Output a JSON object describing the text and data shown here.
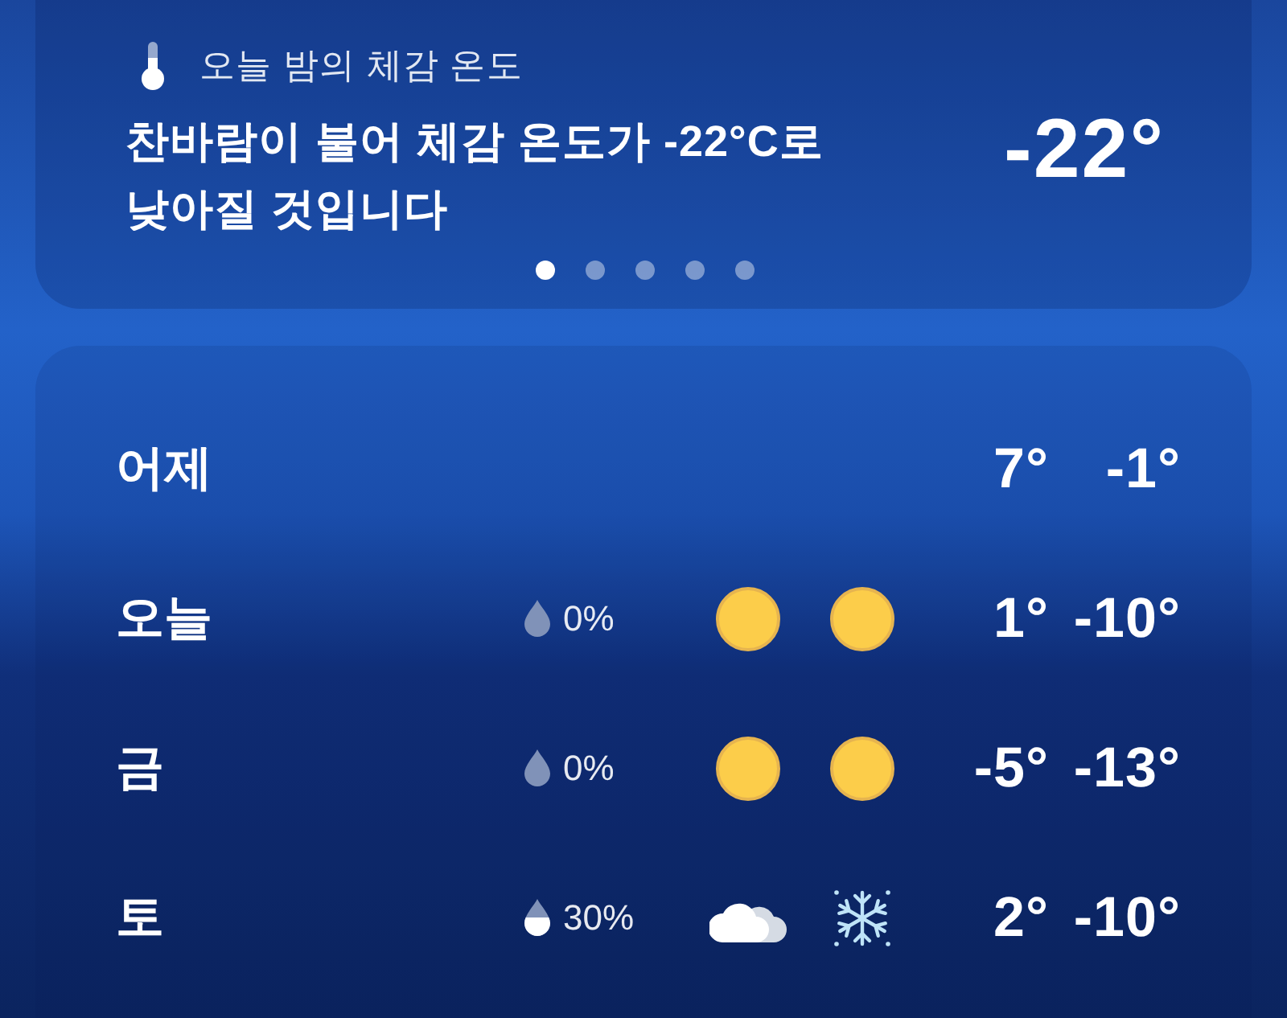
{
  "feels_like_card": {
    "title": "오늘 밤의 체감 온도",
    "message": "찬바람이 불어 체감 온도가 -22°C로 낮아질 것입니다",
    "value": "-22°",
    "pages": [
      {
        "selected": true
      },
      {
        "selected": false
      },
      {
        "selected": false
      },
      {
        "selected": false
      },
      {
        "selected": false
      }
    ]
  },
  "forecast": {
    "days": [
      {
        "day": "어제",
        "high": "7°",
        "low": "-1°"
      },
      {
        "day": "오늘",
        "precip": {
          "text": "0%"
        },
        "icons": [
          {
            "kind": "sun"
          },
          {
            "kind": "sun"
          }
        ],
        "high": "1°",
        "low": "-10°"
      },
      {
        "day": "금",
        "precip": {
          "text": "0%"
        },
        "icons": [
          {
            "kind": "sun"
          },
          {
            "kind": "sun"
          }
        ],
        "high": "-5°",
        "low": "-13°"
      },
      {
        "day": "토",
        "precip": {
          "text": "30%",
          "level": 0.5
        },
        "icons": [
          {
            "kind": "cloud"
          },
          {
            "kind": "snow"
          }
        ],
        "high": "2°",
        "low": "-10°"
      }
    ]
  }
}
